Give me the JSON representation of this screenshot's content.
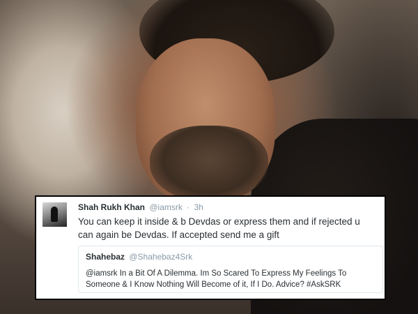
{
  "tweet": {
    "author_name": "Shah Rukh Khan",
    "author_handle": "@iamsrk",
    "separator": "·",
    "time": "3h",
    "text": "You can keep it inside & b Devdas or express them and if rejected u can again be Devdas. If accepted send me a gift"
  },
  "quoted_tweet": {
    "author_name": "Shahebaz",
    "author_handle": "@Shahebaz4Srk",
    "text": "@iamsrk In a Bit Of A Dilemma. Im So Scared To Express My Feelings To Someone & I Know Nothing Will Become of it, If I Do. Advice?  #AskSRK"
  }
}
